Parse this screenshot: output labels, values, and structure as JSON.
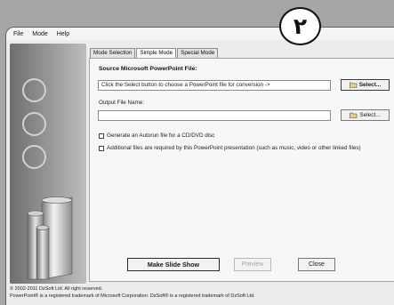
{
  "menu": {
    "items": [
      "File",
      "Mode",
      "Help"
    ]
  },
  "tabs": [
    {
      "label": "Mode Selection",
      "active": false
    },
    {
      "label": "Simple Mode",
      "active": true
    },
    {
      "label": "Special Mode",
      "active": false
    }
  ],
  "source": {
    "label": "Source Microsoft PowerPoint File:",
    "value": "Click the Select button to choose a PowerPoint file for conversion ->",
    "select_label": "Select..."
  },
  "output": {
    "label": "Output File Name:",
    "value": "",
    "select_label": "Select..."
  },
  "options": {
    "autorun": {
      "label": "Generate an Autorun file for a CD/DVD disc",
      "checked": false
    },
    "additional": {
      "label": "Additional files are required by this PowerPoint presentation (such as music, video or other linked files)",
      "checked": false
    }
  },
  "buttons": {
    "make_slide_show": "Make Slide Show",
    "preview": "Preview",
    "close": "Close"
  },
  "footer": {
    "line1": "© 2002-2011 DzSoft Ltd. All right reserved.",
    "line2": "PowerPoint® is a registered trademark of Microsoft Corporation. DzSoft® is a registered trademark of DzSoft Ltd."
  },
  "badge": {
    "number": "٢"
  },
  "icons": {
    "select_button": "folder-open-icon"
  }
}
